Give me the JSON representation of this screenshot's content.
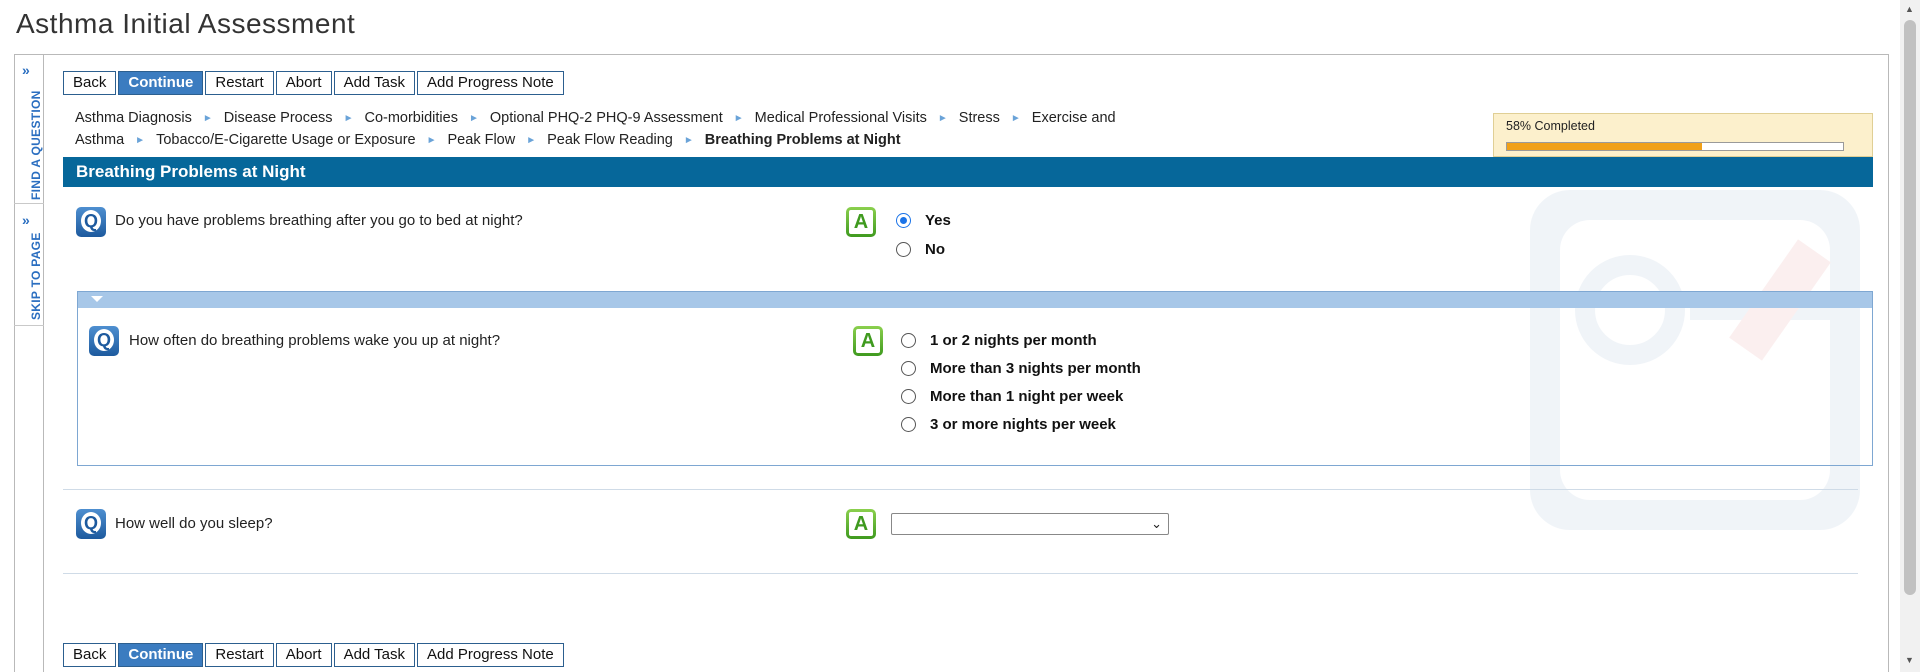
{
  "app_title": "Asthma Initial Assessment",
  "side_rail": {
    "find_question": "FIND A QUESTION",
    "skip_to_page": "SKIP TO PAGE",
    "chevron": "»"
  },
  "toolbar": {
    "back": "Back",
    "continue": "Continue",
    "restart": "Restart",
    "abort": "Abort",
    "add_task": "Add Task",
    "add_progress_note": "Add Progress Note"
  },
  "breadcrumb": {
    "items": [
      "Asthma Diagnosis",
      "Disease Process",
      "Co-morbidities",
      "Optional PHQ-2 PHQ-9 Assessment",
      "Medical Professional Visits",
      "Stress",
      "Exercise and Asthma",
      "Tobacco/E-Cigarette Usage or Exposure",
      "Peak Flow",
      "Peak Flow Reading"
    ],
    "current": "Breathing Problems at Night",
    "separator": "►"
  },
  "progress": {
    "label": "58% Completed",
    "fraction": 0.58
  },
  "section": {
    "title": "Breathing Problems at Night"
  },
  "icons": {
    "q": "Q",
    "a": "A"
  },
  "questions": {
    "q1": {
      "text": "Do you have problems breathing after you go to bed at night?",
      "options": [
        "Yes",
        "No"
      ],
      "selected": "Yes"
    },
    "q2": {
      "text": "How often do breathing problems wake you up at night?",
      "options": [
        "1 or 2 nights per month",
        "More than 3 nights per month",
        "More than 1 night per week",
        "3 or more nights per week"
      ],
      "selected": null
    },
    "q3": {
      "text": "How well do you sleep?",
      "select_value": "",
      "chevron": "⌄"
    }
  }
}
